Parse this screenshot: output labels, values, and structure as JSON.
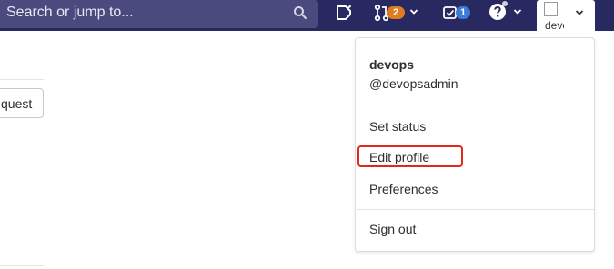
{
  "search": {
    "placeholder": "Search or jump to...",
    "icon": "search-icon"
  },
  "header": {
    "todos_icon": "todo-icon",
    "merge_requests": {
      "icon": "merge-request-icon",
      "count": "2"
    },
    "issues": {
      "icon": "issues-icon",
      "count": "1"
    },
    "help_icon": "help-icon",
    "user": {
      "avatar_alt": "devops",
      "menu_icon": "chevron-down-icon"
    }
  },
  "page": {
    "partial_button": "quest"
  },
  "user_menu": {
    "name": "devops",
    "handle": "@devopsadmin",
    "items": [
      "Set status",
      "Edit profile",
      "Preferences",
      "Sign out"
    ],
    "highlighted_item": "Edit profile"
  },
  "colors": {
    "header_bg": "#292961",
    "search_bg": "#4a4a7e",
    "mr_badge": "#e07b1f",
    "issues_badge": "#3a7bd6",
    "highlight": "#e2271c"
  }
}
